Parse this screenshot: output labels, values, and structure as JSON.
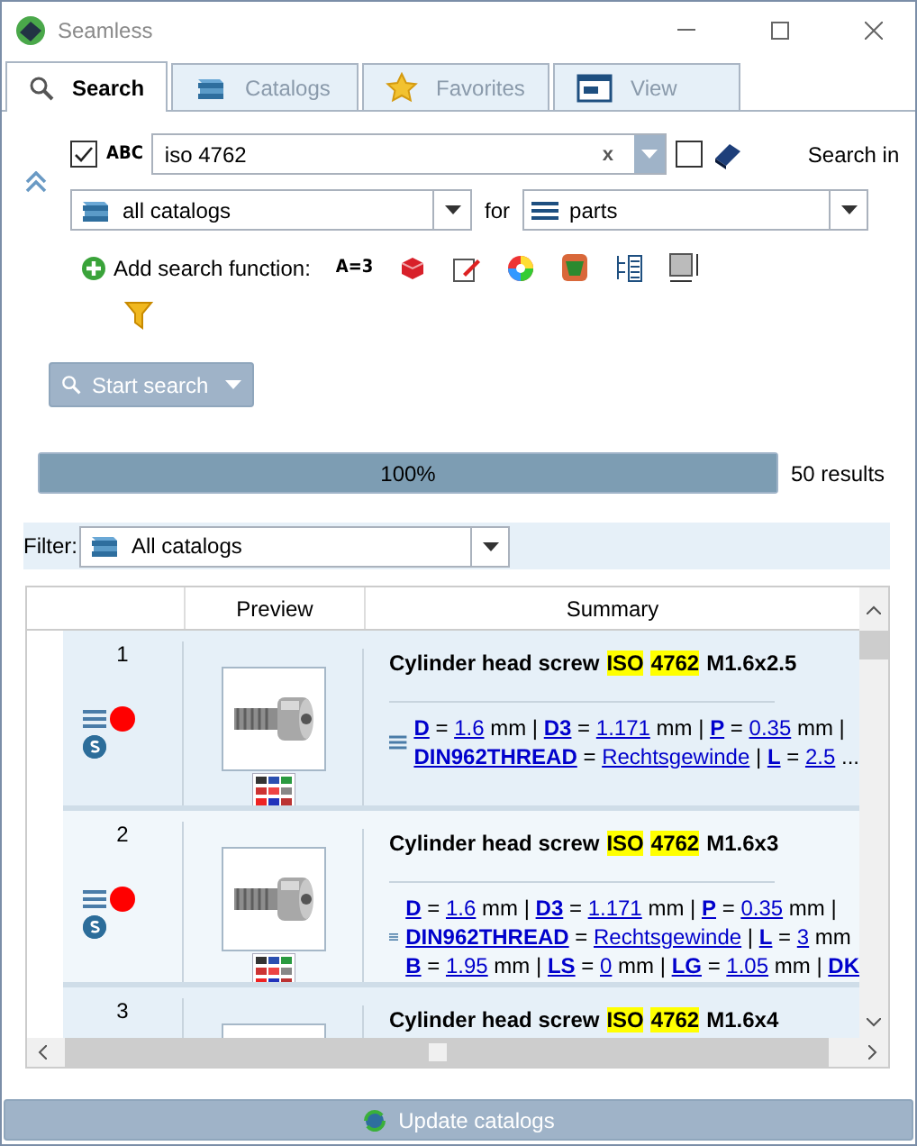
{
  "window": {
    "title": "Seamless"
  },
  "tabs": [
    {
      "label": "Search",
      "selected": true
    },
    {
      "label": "Catalogs",
      "selected": false
    },
    {
      "label": "Favorites",
      "selected": false
    },
    {
      "label": "View",
      "selected": false
    }
  ],
  "search": {
    "text_match_checked": true,
    "text_match_label": "ABC",
    "value": "iso 4762",
    "clear": "x",
    "book_checked": false,
    "search_in_label": "Search in",
    "catalog": "all catalogs",
    "for_label": "for",
    "target": "parts",
    "add_function_label": "Add search function:",
    "function_a_label": "A=3",
    "start_button": "Start search"
  },
  "progress": {
    "level": 1,
    "label": "100%",
    "results": "50 results"
  },
  "filter": {
    "label": "Filter:",
    "value": "All catalogs"
  },
  "table": {
    "columns": [
      "Preview",
      "Summary"
    ],
    "rows": [
      {
        "number": "1",
        "color": "#ff0000",
        "preview_shown": true,
        "title": [
          {
            "text": "Cylinder head screw",
            "highlighted": false
          },
          {
            "text": "ISO",
            "highlighted": true
          },
          {
            "text": "4762",
            "highlighted": true
          },
          {
            "text": "M1.6x2.5",
            "highlighted": false
          }
        ],
        "params": [
          [
            {
              "kind": "name",
              "text": "D"
            },
            {
              "kind": "text",
              "text": " = "
            },
            {
              "kind": "value",
              "text": "1.6"
            },
            {
              "kind": "text",
              "text": " mm | "
            },
            {
              "kind": "name",
              "text": "D3"
            },
            {
              "kind": "text",
              "text": " = "
            },
            {
              "kind": "value",
              "text": "1.171"
            },
            {
              "kind": "text",
              "text": " mm | "
            },
            {
              "kind": "name",
              "text": "P"
            },
            {
              "kind": "text",
              "text": " = "
            },
            {
              "kind": "value",
              "text": "0.35"
            },
            {
              "kind": "text",
              "text": " mm |"
            }
          ],
          [
            {
              "kind": "name",
              "text": "DIN962THREAD"
            },
            {
              "kind": "text",
              "text": " = "
            },
            {
              "kind": "value",
              "text": "Rechtsgewinde"
            },
            {
              "kind": "text",
              "text": " | "
            },
            {
              "kind": "name",
              "text": "L"
            },
            {
              "kind": "text",
              "text": " = "
            },
            {
              "kind": "value",
              "text": "2.5"
            },
            {
              "kind": "text",
              "text": " ..."
            }
          ]
        ]
      },
      {
        "number": "2",
        "color": "#ff0000",
        "preview_shown": true,
        "title": [
          {
            "text": "Cylinder head screw",
            "highlighted": false
          },
          {
            "text": "ISO",
            "highlighted": true
          },
          {
            "text": "4762",
            "highlighted": true
          },
          {
            "text": "M1.6x3",
            "highlighted": false
          }
        ],
        "params": [
          [
            {
              "kind": "name",
              "text": "D"
            },
            {
              "kind": "text",
              "text": " = "
            },
            {
              "kind": "value",
              "text": "1.6"
            },
            {
              "kind": "text",
              "text": " mm | "
            },
            {
              "kind": "name",
              "text": "D3"
            },
            {
              "kind": "text",
              "text": " = "
            },
            {
              "kind": "value",
              "text": "1.171"
            },
            {
              "kind": "text",
              "text": " mm | "
            },
            {
              "kind": "name",
              "text": "P"
            },
            {
              "kind": "text",
              "text": " = "
            },
            {
              "kind": "value",
              "text": "0.35"
            },
            {
              "kind": "text",
              "text": " mm |"
            }
          ],
          [
            {
              "kind": "name",
              "text": "DIN962THREAD"
            },
            {
              "kind": "text",
              "text": " = "
            },
            {
              "kind": "value",
              "text": "Rechtsgewinde"
            },
            {
              "kind": "text",
              "text": " | "
            },
            {
              "kind": "name",
              "text": "L"
            },
            {
              "kind": "text",
              "text": " = "
            },
            {
              "kind": "value",
              "text": "3"
            },
            {
              "kind": "text",
              "text": " mm"
            }
          ],
          [
            {
              "kind": "name",
              "text": "B"
            },
            {
              "kind": "text",
              "text": " = "
            },
            {
              "kind": "value",
              "text": "1.95"
            },
            {
              "kind": "text",
              "text": " mm | "
            },
            {
              "kind": "name",
              "text": "LS"
            },
            {
              "kind": "text",
              "text": " = "
            },
            {
              "kind": "value",
              "text": "0"
            },
            {
              "kind": "text",
              "text": " mm | "
            },
            {
              "kind": "name",
              "text": "LG"
            },
            {
              "kind": "text",
              "text": " = "
            },
            {
              "kind": "value",
              "text": "1.05"
            },
            {
              "kind": "text",
              "text": " mm | "
            },
            {
              "kind": "name",
              "text": "DK"
            }
          ]
        ]
      },
      {
        "number": "3",
        "preview_shown": false,
        "title": [
          {
            "text": "Cylinder head screw",
            "highlighted": false
          },
          {
            "text": "ISO",
            "highlighted": true
          },
          {
            "text": "4762",
            "highlighted": true
          },
          {
            "text": "M1.6x4",
            "highlighted": false
          }
        ]
      }
    ]
  },
  "update_button": "Update catalogs"
}
